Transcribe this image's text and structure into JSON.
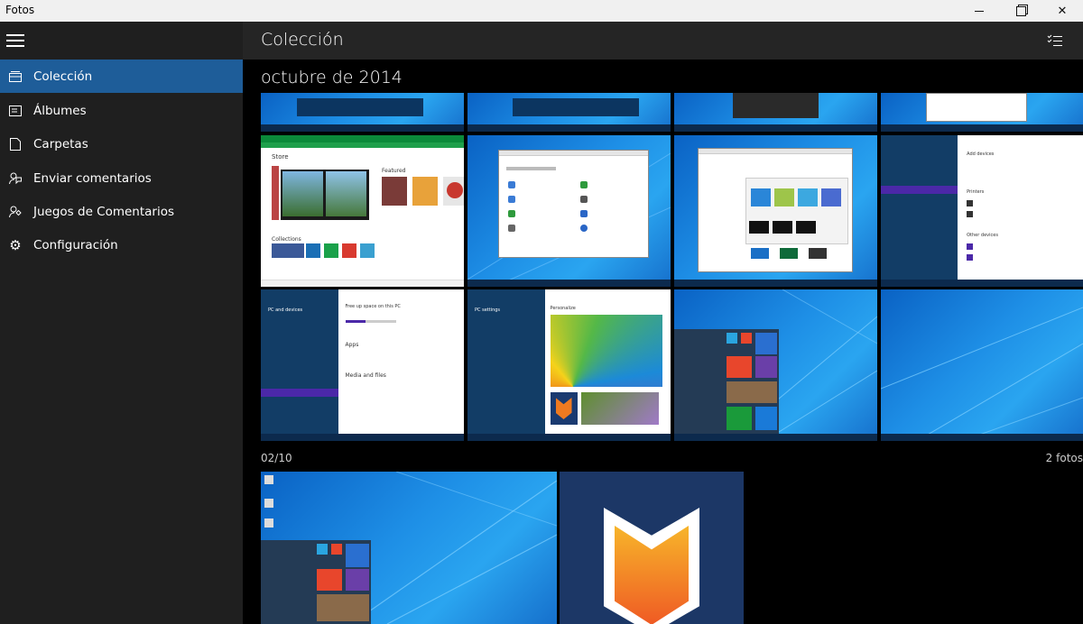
{
  "window": {
    "title": "Fotos",
    "controls": [
      "minimize-icon",
      "maximize-icon",
      "close-icon"
    ]
  },
  "sidebar": {
    "menu_icon": "hamburger-icon",
    "items": [
      {
        "label": "Colección",
        "icon": "collection-icon",
        "selected": true
      },
      {
        "label": "Álbumes",
        "icon": "album-icon",
        "selected": false
      },
      {
        "label": "Carpetas",
        "icon": "folder-icon",
        "selected": false
      },
      {
        "label": "Enviar comentarios",
        "icon": "feedback-icon",
        "selected": false
      },
      {
        "label": "Juegos de Comentarios",
        "icon": "feedback-games-icon",
        "selected": false
      },
      {
        "label": "Configuración",
        "icon": "gear-icon",
        "selected": false
      }
    ]
  },
  "header": {
    "title": "Colección",
    "select_icon": "select-multiple-icon"
  },
  "groups": [
    {
      "title": "octubre de 2014"
    },
    {
      "date": "02/10",
      "count": "2 fotos"
    }
  ],
  "thumbs": {
    "store_title": "Store",
    "store_featured": "Featured",
    "store_collections": "Collections",
    "pc_devices": "PC and devices",
    "pc_settings": "PC settings",
    "free_up": "Free up space on this PC",
    "apps": "Apps",
    "media": "Media and files",
    "personalize": "Personalize",
    "add_devices": "Add devices",
    "printers": "Printers",
    "other_devices": "Other devices"
  },
  "colors": {
    "accent": "#1e5d99",
    "sidebar": "#1f1f1f",
    "header": "#252525"
  }
}
